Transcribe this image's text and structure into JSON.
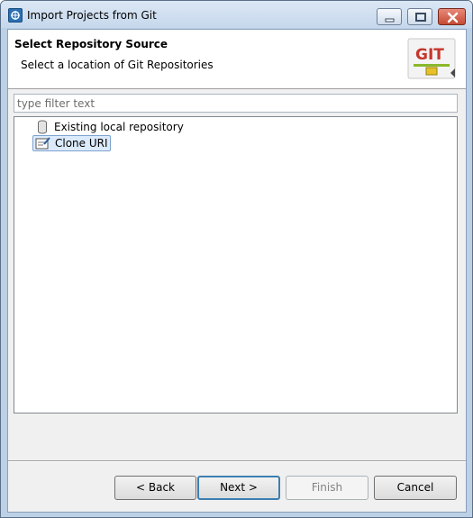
{
  "window": {
    "title": "Import Projects from Git"
  },
  "header": {
    "title": "Select Repository Source",
    "subtitle": "Select a location of Git Repositories",
    "logo_text": "GIT"
  },
  "filter": {
    "placeholder": "type filter text",
    "value": ""
  },
  "tree": {
    "items": [
      {
        "label": "Existing local repository",
        "icon": "repository-icon",
        "selected": false
      },
      {
        "label": "Clone URI",
        "icon": "clone-uri-icon",
        "selected": true
      }
    ]
  },
  "buttons": {
    "back": "< Back",
    "next": "Next >",
    "finish": "Finish",
    "cancel": "Cancel"
  },
  "colors": {
    "titlebar": "#c6d8ec",
    "selection": "#dcebfc",
    "default_button_border": "#3c7fb1",
    "close_button": "#c44a34"
  }
}
